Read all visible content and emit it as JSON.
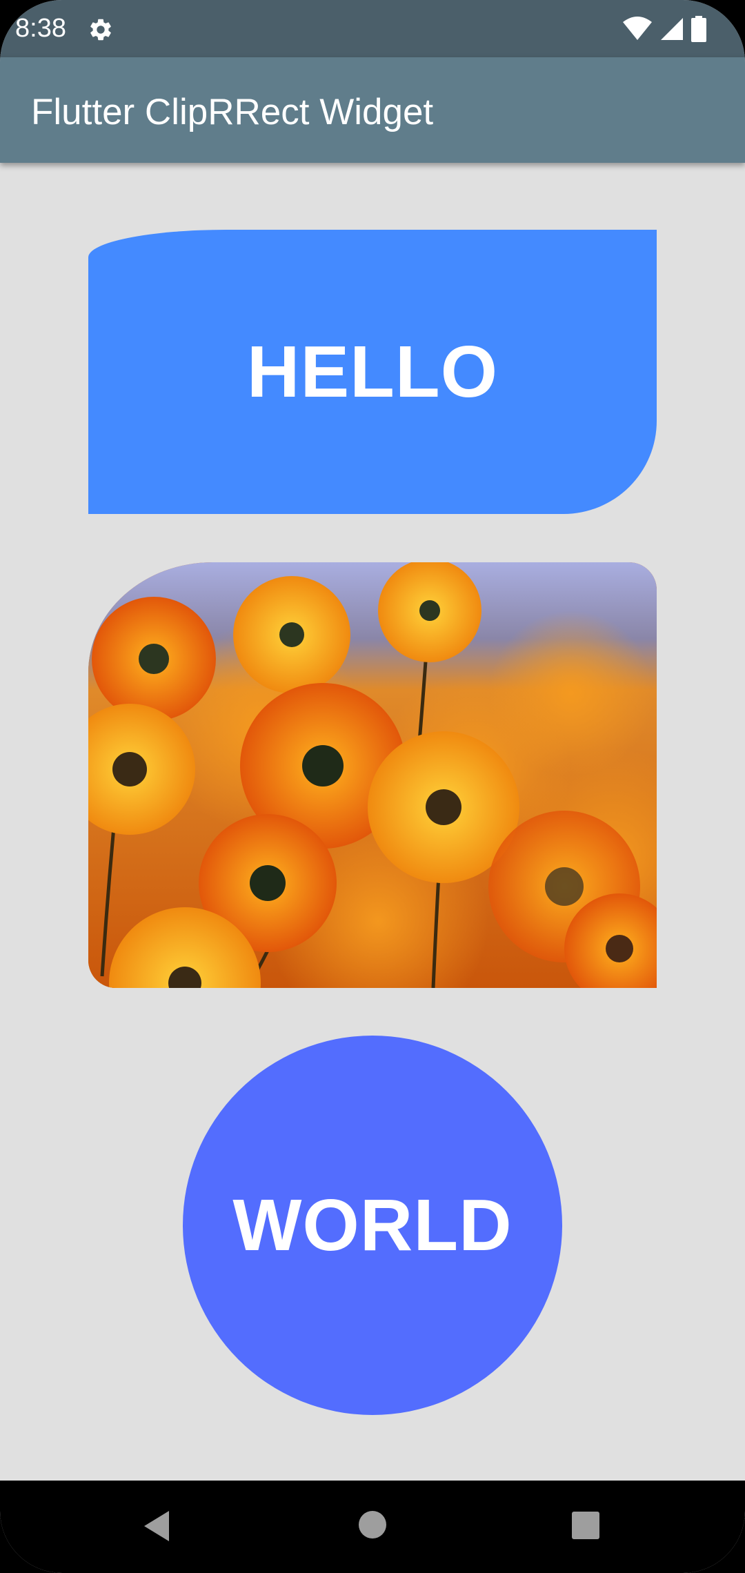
{
  "status_bar": {
    "time": "8:38",
    "icons": [
      "settings-gear-icon",
      "wifi-icon",
      "signal-icon",
      "battery-icon"
    ]
  },
  "app_bar": {
    "title": "Flutter ClipRRect Widget",
    "color": "#607d8b"
  },
  "content": {
    "hello_label": "HELLO",
    "hello_color": "#448aff",
    "image_name": "orange-flowers-image",
    "world_label": "WORLD",
    "world_color": "#536dfe",
    "background": "#e0e0e0"
  },
  "nav_bar": {
    "buttons": [
      "back-icon",
      "home-icon",
      "recent-apps-icon"
    ]
  }
}
